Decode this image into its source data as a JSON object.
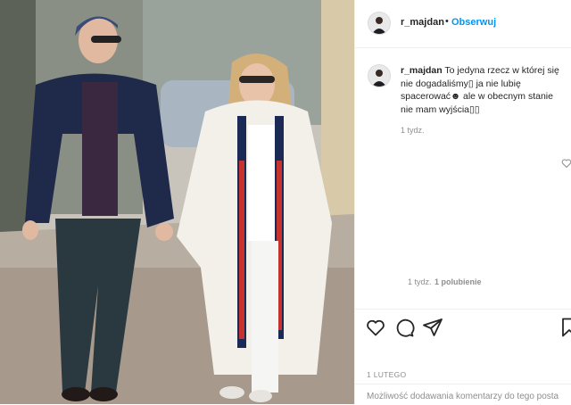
{
  "post": {
    "username": "r_majdan",
    "separator": "•",
    "follow_label": "Obserwuj",
    "caption_text": "To jedyna rzecz w której się nie dogadaliśmy▯ ja nie lubię spacerować☻ ale w obecnym stanie nie mam wyjścia▯▯",
    "caption_time": "1 tydz.",
    "reply_time": "1 tydz.",
    "reply_likes": "1 polubienie",
    "date": "1 LUTEGO",
    "comment_disabled": "Możliwość dodawania komentarzy do tego posta"
  },
  "icons": [
    "heart-icon",
    "comment-icon",
    "share-icon",
    "bookmark-icon"
  ],
  "colors": {
    "link": "#0095f6",
    "text": "#262626",
    "muted": "#8e8e8e",
    "border": "#efefef"
  }
}
